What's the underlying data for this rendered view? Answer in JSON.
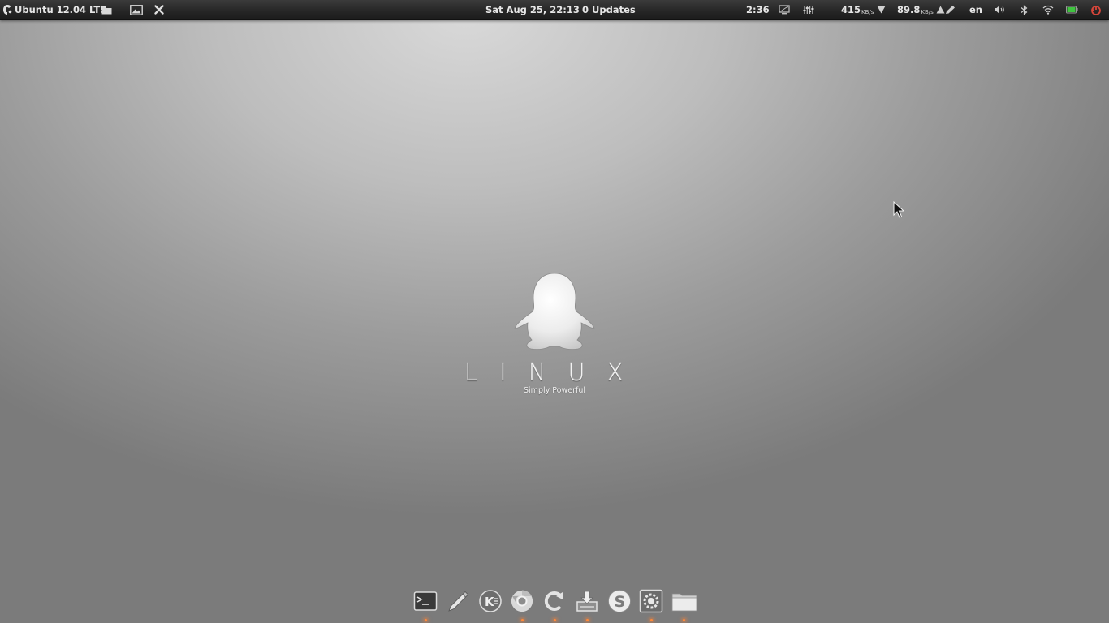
{
  "panel": {
    "menu_title": "Ubuntu 12.04 LTS",
    "icons_left": [
      "folder-icon",
      "image-icon",
      "close-icon"
    ],
    "datetime": "Sat Aug 25, 22:13",
    "updates": "0 Updates",
    "battery_time": "2:36",
    "download_speed": "415",
    "upload_speed": "89.8",
    "speed_unit": "KB/s",
    "language": "en",
    "icons_right": [
      "display-icon",
      "equalizer-icon",
      "arrow-down-icon",
      "arrow-up-icon",
      "pen-icon",
      "volume-icon",
      "bluetooth-icon",
      "wifi-icon",
      "battery-icon",
      "power-icon"
    ]
  },
  "wallpaper": {
    "logo_word": "LINUX",
    "tagline": "Simply Powerful"
  },
  "dock": {
    "items": [
      {
        "name": "terminal-icon",
        "running": true
      },
      {
        "name": "pen-icon",
        "running": false
      },
      {
        "name": "kde-icon",
        "running": false
      },
      {
        "name": "chrome-icon",
        "running": true
      },
      {
        "name": "update-icon",
        "running": true
      },
      {
        "name": "install-icon",
        "running": true
      },
      {
        "name": "skype-icon",
        "running": false
      },
      {
        "name": "settings-icon",
        "running": true
      },
      {
        "name": "folder-icon",
        "running": true
      }
    ]
  },
  "colors": {
    "panel_bg": "#252525",
    "panel_text": "#e6e6e6",
    "battery_green": "#3fc43f",
    "power_red": "#d9463a",
    "indicator_orange": "#ff8a3a"
  }
}
